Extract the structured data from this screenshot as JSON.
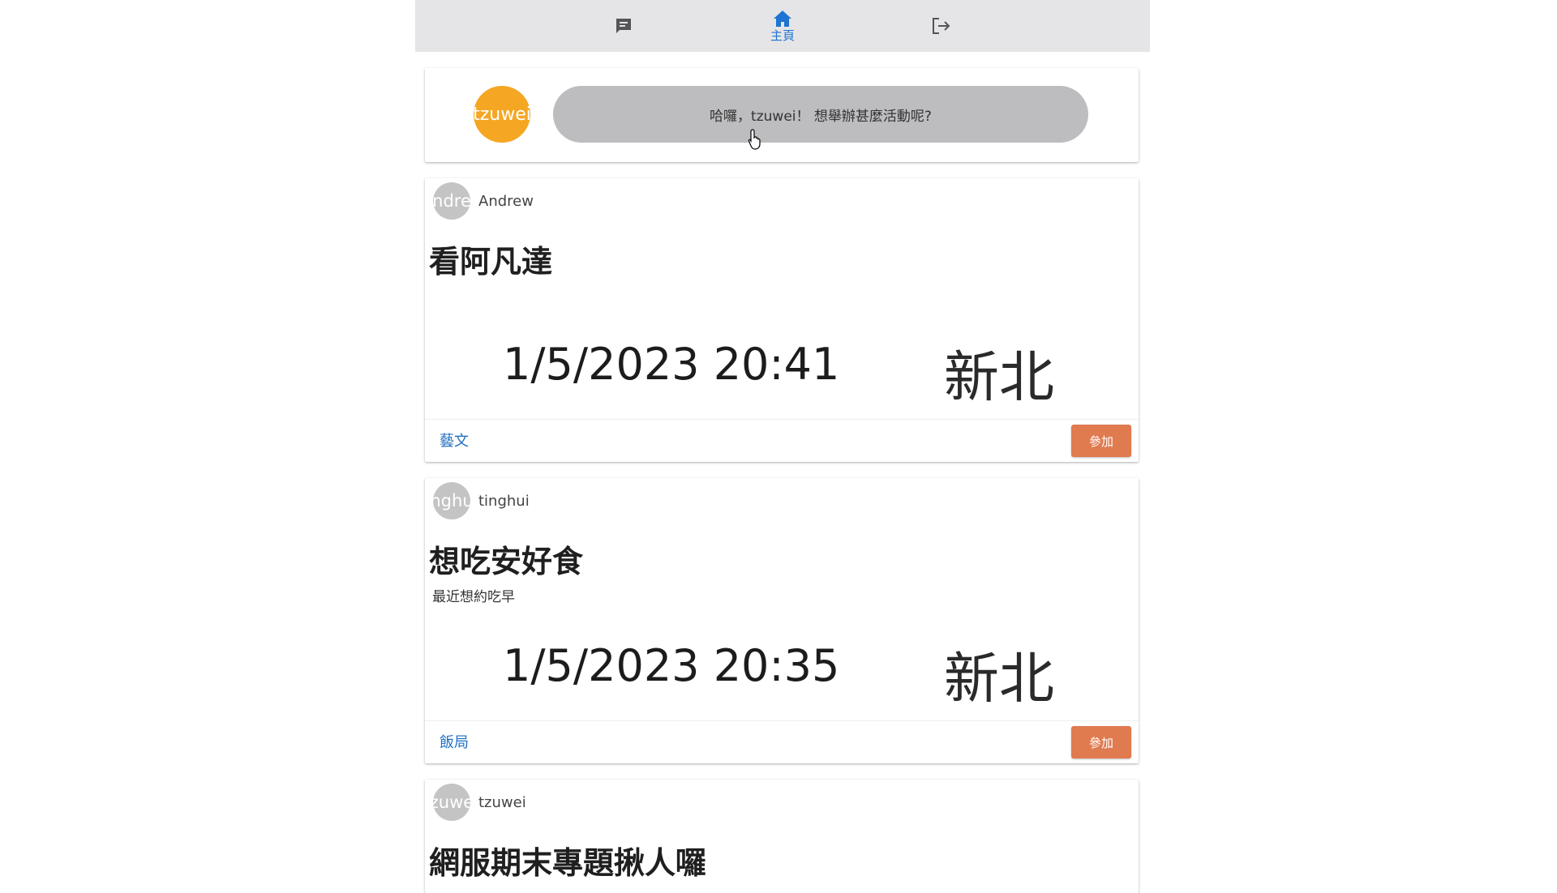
{
  "navbar": {
    "items": [
      {
        "icon": "chat-icon",
        "label": ""
      },
      {
        "icon": "home-icon",
        "label": "主頁",
        "active": true
      },
      {
        "icon": "logout-icon",
        "label": ""
      }
    ],
    "active_color": "#1e74d0"
  },
  "compose": {
    "avatar_text": "tzuwei",
    "avatar_color": "#f5a623",
    "prompt": "哈囉，tzuwei！ 想舉辦甚麼活動呢?"
  },
  "events": [
    {
      "user_name": "Andrew",
      "avatar_text": "ndre",
      "title": "看阿凡達",
      "description": "",
      "datetime": "1/5/2023 20:41",
      "location": "新北",
      "category": "藝文",
      "join_label": "參加"
    },
    {
      "user_name": "tinghui",
      "avatar_text": "nghu",
      "title": "想吃安好食",
      "description": "最近想約吃早",
      "datetime": "1/5/2023 20:35",
      "location": "新北",
      "category": "飯局",
      "join_label": "參加"
    },
    {
      "user_name": "tzuwei",
      "avatar_text": "zuwe",
      "title": "網服期末專題揪人囉"
    }
  ],
  "colors": {
    "join_button": "#e07a4f",
    "category_link": "#1e6fc2",
    "navbar_bg": "#e5e5e7"
  }
}
